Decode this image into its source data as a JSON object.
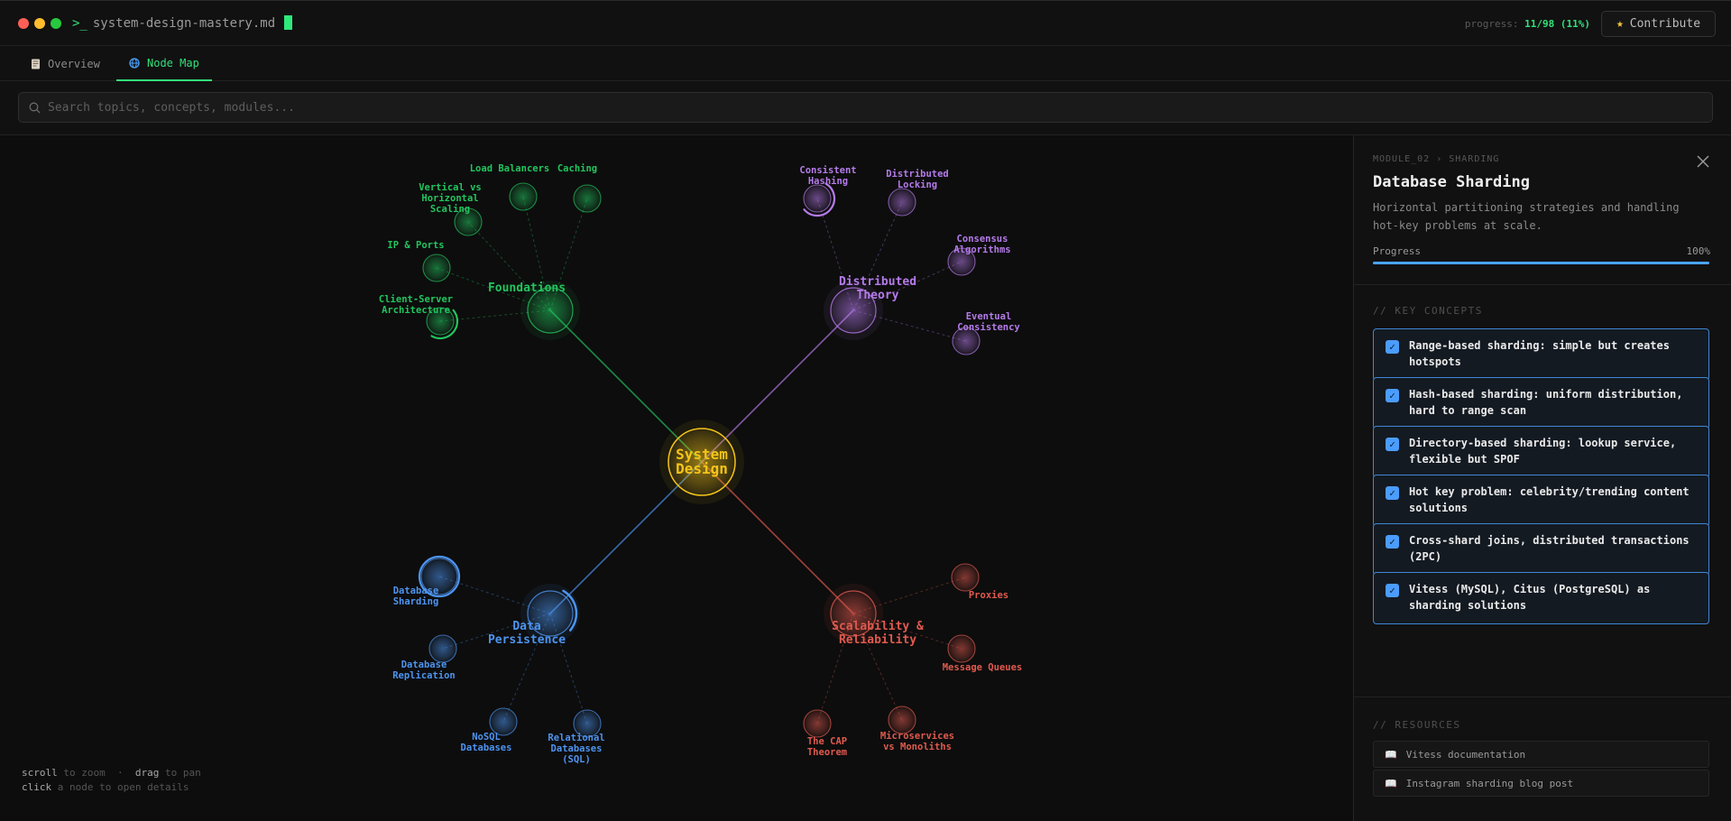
{
  "window": {
    "prompt": ">_",
    "filename": "system-design-mastery.md",
    "progress_label": "progress:",
    "progress_value": "11/98 (11%)",
    "contribute_label": "Contribute"
  },
  "tabs": [
    {
      "label": "Overview",
      "icon": "document-icon",
      "active": false
    },
    {
      "label": "Node Map",
      "icon": "globe-icon",
      "active": true
    }
  ],
  "search": {
    "placeholder": "Search topics, concepts, modules..."
  },
  "map": {
    "root": {
      "label_line1": "System",
      "label_line2": "Design",
      "color": "#f5c518"
    },
    "branches": [
      {
        "id": "foundations",
        "lines": [
          "Foundations"
        ],
        "color": "#22c55e",
        "children": [
          {
            "lines": [
              "Load Balancers"
            ]
          },
          {
            "lines": [
              "Caching"
            ]
          },
          {
            "lines": [
              "Vertical vs",
              "Horizontal",
              "Scaling"
            ]
          },
          {
            "lines": [
              "IP & Ports"
            ]
          },
          {
            "lines": [
              "Client-Server",
              "Architecture"
            ]
          }
        ]
      },
      {
        "id": "distributed",
        "lines": [
          "Distributed",
          "Theory"
        ],
        "color": "#b57bea",
        "children": [
          {
            "lines": [
              "Consistent",
              "Hashing"
            ]
          },
          {
            "lines": [
              "Distributed",
              "Locking"
            ]
          },
          {
            "lines": [
              "Consensus",
              "Algorithms"
            ]
          },
          {
            "lines": [
              "Eventual",
              "Consistency"
            ]
          }
        ]
      },
      {
        "id": "persistence",
        "lines": [
          "Data",
          "Persistence"
        ],
        "color": "#4d94f0",
        "children": [
          {
            "lines": [
              "Database",
              "Sharding"
            ]
          },
          {
            "lines": [
              "Database",
              "Replication"
            ]
          },
          {
            "lines": [
              "NoSQL",
              "Databases"
            ]
          },
          {
            "lines": [
              "Relational",
              "Databases",
              "(SQL)"
            ]
          }
        ]
      },
      {
        "id": "scalability",
        "lines": [
          "Scalability &",
          "Reliability"
        ],
        "color": "#e05a4f",
        "children": [
          {
            "lines": [
              "Proxies"
            ]
          },
          {
            "lines": [
              "Message Queues"
            ]
          },
          {
            "lines": [
              "The CAP",
              "Theorem"
            ]
          },
          {
            "lines": [
              "Microservices",
              "vs Monoliths"
            ]
          }
        ]
      }
    ],
    "hints": {
      "scroll": "scroll",
      "scroll_action": "to zoom",
      "sep": "·",
      "drag": "drag",
      "drag_action": "to pan",
      "click": "click",
      "click_action": "a node to open details"
    }
  },
  "panel": {
    "breadcrumb": "MODULE_02 › SHARDING",
    "title": "Database Sharding",
    "description": "Horizontal partitioning strategies and handling hot-key problems at scale.",
    "progress_label": "Progress",
    "progress_percent_text": "100%",
    "progress_fraction": 1.0,
    "key_concepts_heading": "// KEY CONCEPTS",
    "concepts": [
      {
        "text": "Range-based sharding: simple but creates hotspots",
        "checked": true
      },
      {
        "text": "Hash-based sharding: uniform distribution, hard to range scan",
        "checked": true
      },
      {
        "text": "Directory-based sharding: lookup service, flexible but SPOF",
        "checked": true
      },
      {
        "text": "Hot key problem: celebrity/trending content solutions",
        "checked": true
      },
      {
        "text": "Cross-shard joins, distributed transactions (2PC)",
        "checked": true
      },
      {
        "text": "Vitess (MySQL), Citus (PostgreSQL) as sharding solutions",
        "checked": true
      }
    ],
    "resources_heading": "// RESOURCES",
    "resources": [
      {
        "label": "Vitess documentation",
        "icon": "book-icon"
      },
      {
        "label": "Instagram sharding blog post",
        "icon": "book-icon"
      }
    ]
  }
}
